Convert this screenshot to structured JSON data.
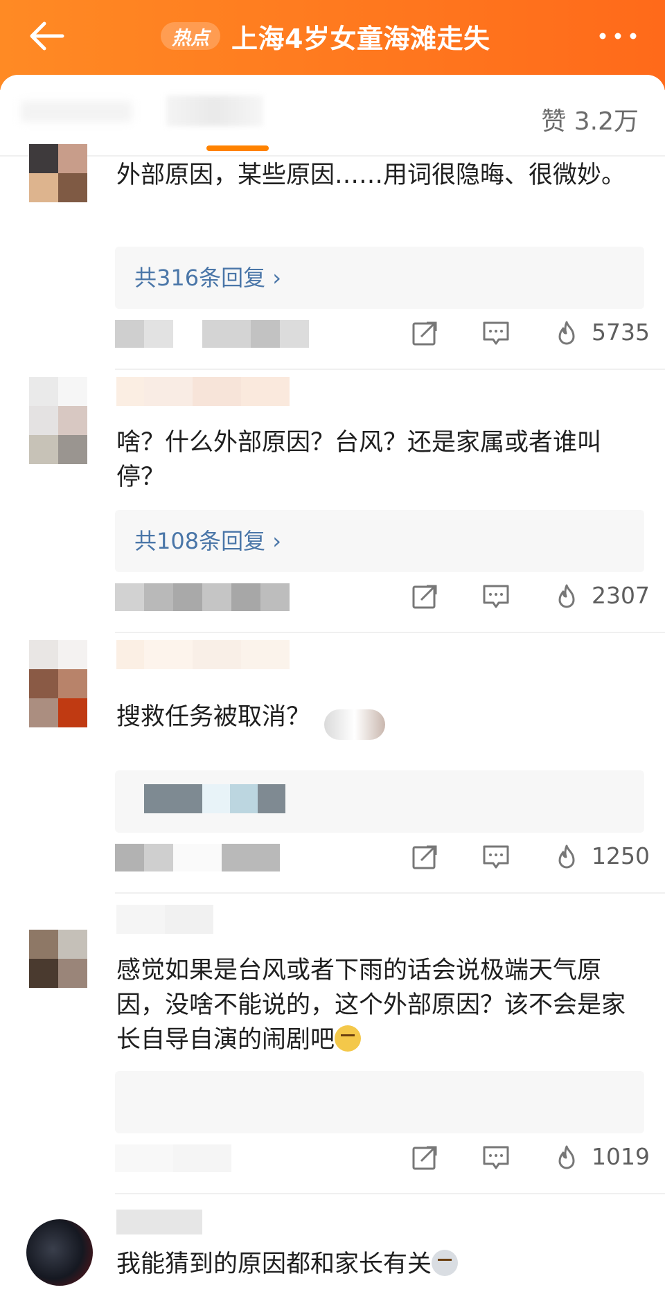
{
  "header": {
    "back_icon": "arrow-left-icon",
    "hot_badge": "热点",
    "title": "上海4岁女童海滩走失",
    "more_icon": "more-dots-icon",
    "bg_color": "#ff7a1e"
  },
  "topbar": {
    "likes_total": "赞 3.2万",
    "indicator_color": "#ff8200"
  },
  "comments": [
    {
      "text": "外部原因，某些原因……用词很隐晦、很微妙。",
      "reply_link": "共316条回复 ›",
      "like_count": "5735"
    },
    {
      "text": "啥？什么外部原因？台风？还是家属或者谁叫停？",
      "reply_link": "共108条回复 ›",
      "like_count": "2307"
    },
    {
      "text": "搜救任务被取消？",
      "like_count": "1250"
    },
    {
      "text": "感觉如果是台风或者下雨的话会说极端天气原因，没啥不能说的，这个外部原因？该不会是家长自导自演的闹剧吧",
      "like_count": "1019"
    },
    {
      "text": "我能猜到的原因都和家长有关"
    }
  ],
  "icons": {
    "share": "share-icon",
    "comment": "comment-icon",
    "like": "like-flame-icon"
  }
}
